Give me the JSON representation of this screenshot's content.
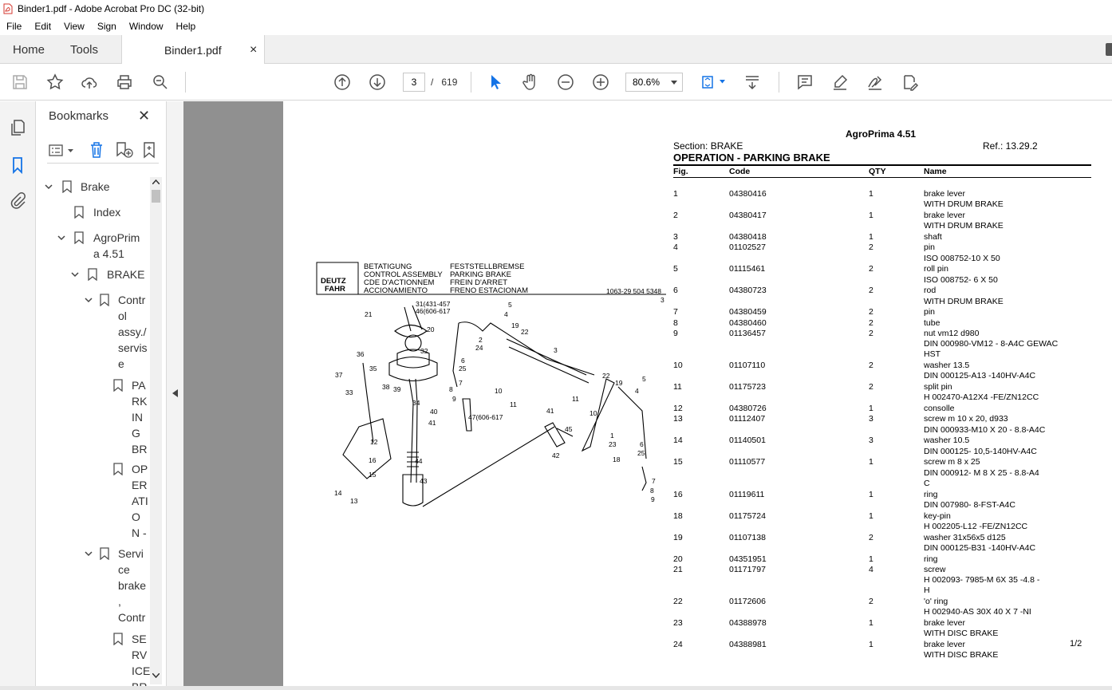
{
  "window": {
    "title": "Binder1.pdf - Adobe Acrobat Pro DC (32-bit)"
  },
  "menu": [
    "File",
    "Edit",
    "View",
    "Sign",
    "Window",
    "Help"
  ],
  "tabs": {
    "home": "Home",
    "tools": "Tools",
    "document": "Binder1.pdf",
    "close": "×"
  },
  "toolbar": {
    "page_current": "3",
    "page_separator": "/",
    "page_total": "619",
    "zoom": "80.6%"
  },
  "bookmarks": {
    "title": "Bookmarks",
    "items": [
      {
        "label": "Brake"
      },
      {
        "label": "Index"
      },
      {
        "label_lines": [
          "AgroPrim",
          "a 4.51"
        ]
      },
      {
        "label": "BRAKE"
      },
      {
        "label_lines": [
          "Contr",
          "ol",
          "assy./",
          "servis",
          "e"
        ]
      },
      {
        "label_lines": [
          "PA",
          "RK",
          "IN",
          "G",
          "BR"
        ]
      },
      {
        "label_lines": [
          "OP",
          "ER",
          "ATI",
          "O",
          "N -"
        ]
      },
      {
        "label_lines": [
          "Servi",
          "ce",
          "brake",
          ",",
          "Contr"
        ]
      },
      {
        "label_lines": [
          "SE",
          "RV",
          "ICE",
          "BR"
        ]
      }
    ]
  },
  "document": {
    "model": "AgroPrima 4.51",
    "section": "Section: BRAKE",
    "ref": "Ref.: 13.29.2",
    "operation": "OPERATION - PARKING BRAKE",
    "columns": {
      "fig": "Fig.",
      "code": "Code",
      "qty": "QTY",
      "name": "Name"
    },
    "rows": [
      {
        "fig": "1",
        "code": "04380416",
        "qty": "1",
        "name": [
          "brake lever",
          "WITH DRUM BRAKE"
        ]
      },
      {
        "fig": "2",
        "code": "04380417",
        "qty": "1",
        "name": [
          "brake lever",
          "WITH DRUM BRAKE"
        ]
      },
      {
        "fig": "3",
        "code": "04380418",
        "qty": "1",
        "name": [
          "shaft"
        ]
      },
      {
        "fig": "4",
        "code": "01102527",
        "qty": "2",
        "name": [
          "pin",
          "ISO 008752-10 X 50"
        ]
      },
      {
        "fig": "5",
        "code": "01115461",
        "qty": "2",
        "name": [
          "roll pin",
          "ISO 008752- 6 X 50"
        ]
      },
      {
        "fig": "6",
        "code": "04380723",
        "qty": "2",
        "name": [
          "rod",
          "WITH DRUM BRAKE"
        ]
      },
      {
        "fig": "7",
        "code": "04380459",
        "qty": "2",
        "name": [
          "pin"
        ]
      },
      {
        "fig": "8",
        "code": "04380460",
        "qty": "2",
        "name": [
          "tube"
        ]
      },
      {
        "fig": "9",
        "code": "01136457",
        "qty": "2",
        "name": [
          "nut vm12 d980",
          "DIN 000980-VM12 - 8-A4C GEWAC",
          "HST"
        ]
      },
      {
        "fig": "10",
        "code": "01107110",
        "qty": "2",
        "name": [
          "washer 13.5",
          "DIN 000125-A13 -140HV-A4C"
        ]
      },
      {
        "fig": "11",
        "code": "01175723",
        "qty": "2",
        "name": [
          "split pin",
          "H 002470-A12X4 -FE/ZN12CC"
        ]
      },
      {
        "fig": "12",
        "code": "04380726",
        "qty": "1",
        "name": [
          "consolle"
        ]
      },
      {
        "fig": "13",
        "code": "01112407",
        "qty": "3",
        "name": [
          "screw m 10 x 20, d933",
          "DIN 000933-M10 X 20 - 8.8-A4C"
        ]
      },
      {
        "fig": "14",
        "code": "01140501",
        "qty": "3",
        "name": [
          "washer 10.5",
          "DIN 000125- 10,5-140HV-A4C"
        ]
      },
      {
        "fig": "15",
        "code": "01110577",
        "qty": "1",
        "name": [
          "screw m 8 x 25",
          "DIN 000912- M 8 X 25 - 8.8-A4",
          "C"
        ]
      },
      {
        "fig": "16",
        "code": "01119611",
        "qty": "1",
        "name": [
          "ring",
          "DIN 007980- 8-FST-A4C"
        ]
      },
      {
        "fig": "18",
        "code": "01175724",
        "qty": "1",
        "name": [
          "key-pin",
          "H 002205-L12 -FE/ZN12CC"
        ]
      },
      {
        "fig": "19",
        "code": "01107138",
        "qty": "2",
        "name": [
          "washer 31x56x5 d125",
          "DIN 000125-B31 -140HV-A4C"
        ]
      },
      {
        "fig": "20",
        "code": "04351951",
        "qty": "1",
        "name": [
          "ring"
        ]
      },
      {
        "fig": "21",
        "code": "01171797",
        "qty": "4",
        "name": [
          "screw",
          "H 002093- 7985-M 6X 35 -4.8 -",
          "H"
        ]
      },
      {
        "fig": "22",
        "code": "01172606",
        "qty": "2",
        "name": [
          "'o' ring",
          "H 002940-AS 30X 40 X 7 -NI"
        ]
      },
      {
        "fig": "23",
        "code": "04388978",
        "qty": "1",
        "name": [
          "brake lever",
          "WITH DISC BRAKE"
        ]
      },
      {
        "fig": "24",
        "code": "04388981",
        "qty": "1",
        "name": [
          "brake lever",
          "WITH DISC BRAKE"
        ]
      }
    ],
    "page_indicator": "1/2"
  },
  "diagram": {
    "logo": [
      "DEUTZ",
      "FAHR"
    ],
    "titles_col1": [
      "BETATIGUNG",
      "CONTROL ASSEMBLY",
      "CDE D'ACTIONNEM",
      "ACCIONAMIENTO"
    ],
    "titles_col2": [
      "FESTSTELLBREMSE",
      "PARKING BRAKE",
      "FREIN D'ARRET",
      "FRENO ESTACIONAM"
    ],
    "code": "1063-29 504 5348",
    "labels": [
      "3",
      "31(431-457",
      "46(606-617",
      "5",
      "4",
      "19",
      "22",
      "2",
      "24",
      "21",
      "20",
      "32",
      "36",
      "35",
      "37",
      "33",
      "38",
      "39",
      "34",
      "40",
      "41",
      "25",
      "6",
      "7",
      "8",
      "9",
      "10",
      "11",
      "47(606-617",
      "3",
      "22",
      "19",
      "5",
      "4",
      "11",
      "10",
      "1",
      "23",
      "18",
      "6",
      "25",
      "7",
      "8",
      "9",
      "41",
      "45",
      "42",
      "12",
      "16",
      "15",
      "14",
      "13",
      "44",
      "43"
    ]
  },
  "colors": {
    "canvas_bg": "#909090",
    "accent_blue": "#1473e6",
    "icon_gray": "#505050"
  }
}
